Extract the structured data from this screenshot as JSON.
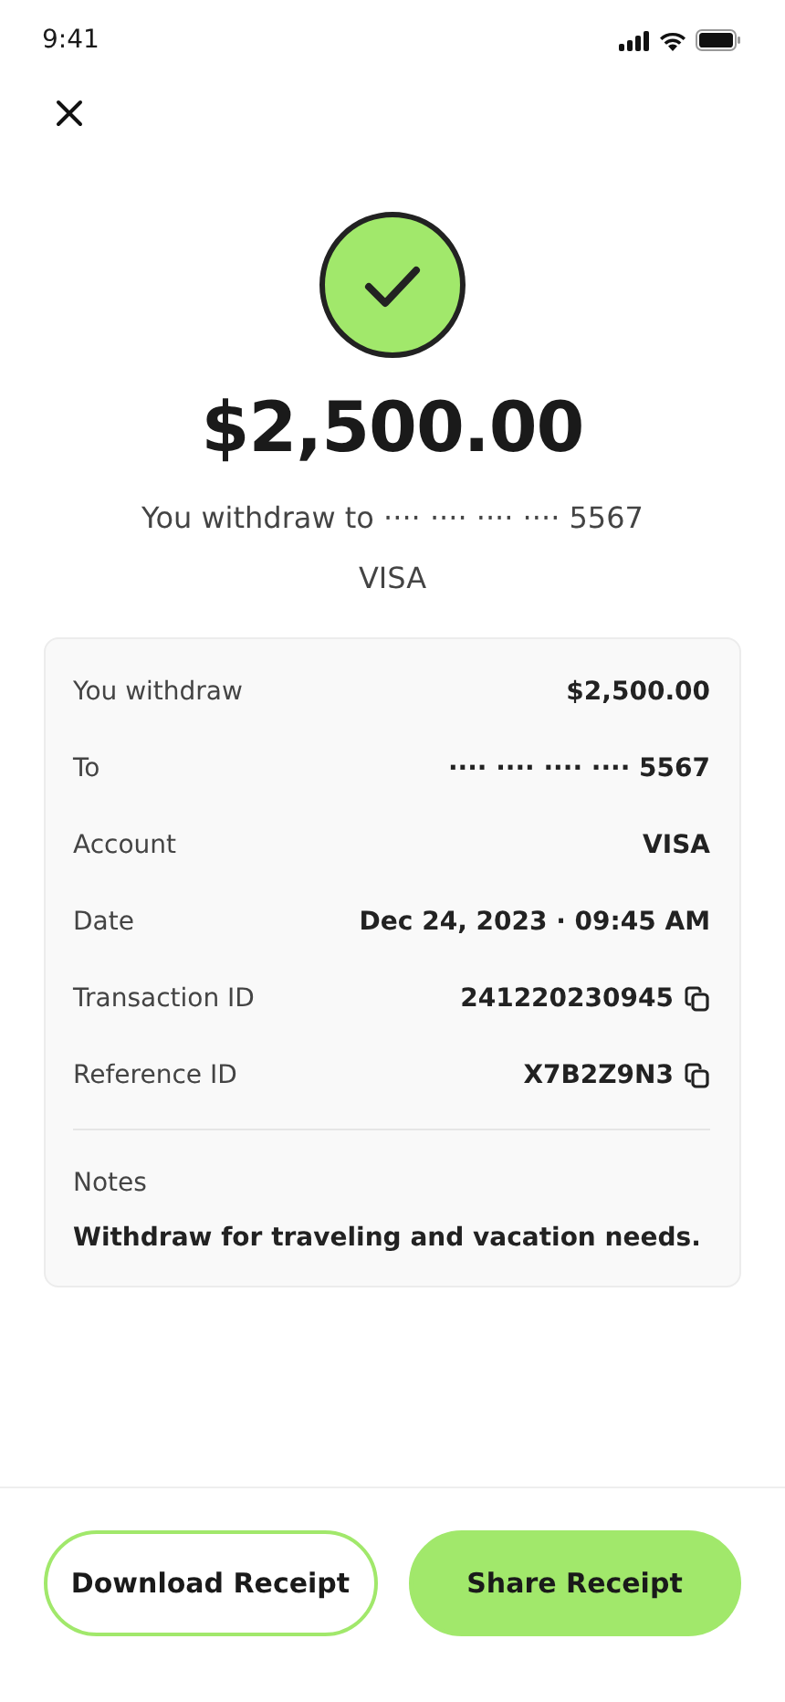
{
  "status_bar": {
    "time": "9:41"
  },
  "amount": "$2,500.00",
  "subtitle": "You withdraw to ···· ···· ···· ···· 5567",
  "network": "VISA",
  "details": [
    {
      "label": "You withdraw",
      "value": "$2,500.00",
      "copyable": false
    },
    {
      "label": "To",
      "value": "···· ···· ···· ···· 5567",
      "copyable": false
    },
    {
      "label": "Account",
      "value": "VISA",
      "copyable": false
    },
    {
      "label": "Date",
      "value": "Dec 24, 2023 · 09:45 AM",
      "copyable": false
    },
    {
      "label": "Transaction ID",
      "value": "241220230945",
      "copyable": true
    },
    {
      "label": "Reference ID",
      "value": "X7B2Z9N3",
      "copyable": true
    }
  ],
  "notes": {
    "label": "Notes",
    "text": "Withdraw for traveling and vacation needs."
  },
  "buttons": [
    {
      "label": "Download Receipt",
      "kind": "outline"
    },
    {
      "label": "Share Receipt",
      "kind": "filled"
    }
  ]
}
